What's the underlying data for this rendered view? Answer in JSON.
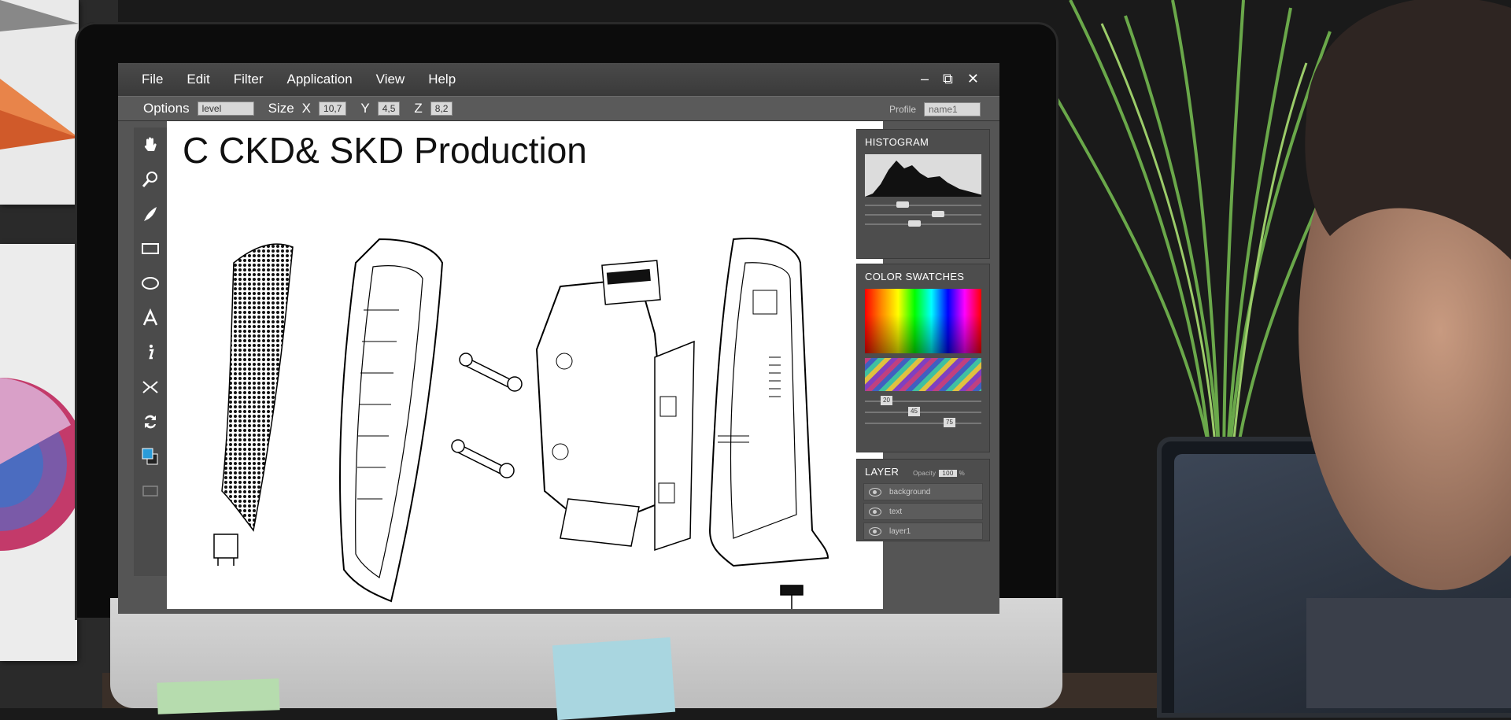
{
  "menubar": {
    "items": [
      "File",
      "Edit",
      "Filter",
      "Application",
      "View",
      "Help"
    ],
    "window_controls": [
      "–",
      "⧉",
      "✕"
    ]
  },
  "options_bar": {
    "options_label": "Options",
    "options_value": "level",
    "size_label": "Size",
    "x_label": "X",
    "x_value": "10,7",
    "y_label": "Y",
    "y_value": "4,5",
    "z_label": "Z",
    "z_value": "8,2",
    "profile_label": "Profile",
    "profile_value": "name1"
  },
  "toolbox": {
    "tools": [
      "hand-icon",
      "zoom-icon",
      "brush-icon",
      "rectangle-icon",
      "ellipse-icon",
      "text-icon",
      "info-icon",
      "transform-icon",
      "swap-icon",
      "color-picker-icon",
      "screen-mode-icon"
    ]
  },
  "canvas": {
    "title": "C CKD& SKD Production"
  },
  "panels": {
    "histogram_title": "HISTOGRAM",
    "swatches_title": "COLOR SWATCHES",
    "swatch_values": [
      "20",
      "45",
      "75"
    ],
    "layer_title": "LAYER",
    "opacity_label": "Opacity",
    "opacity_value": "100",
    "opacity_unit": "%",
    "layers": [
      "background",
      "text",
      "layer1"
    ]
  }
}
